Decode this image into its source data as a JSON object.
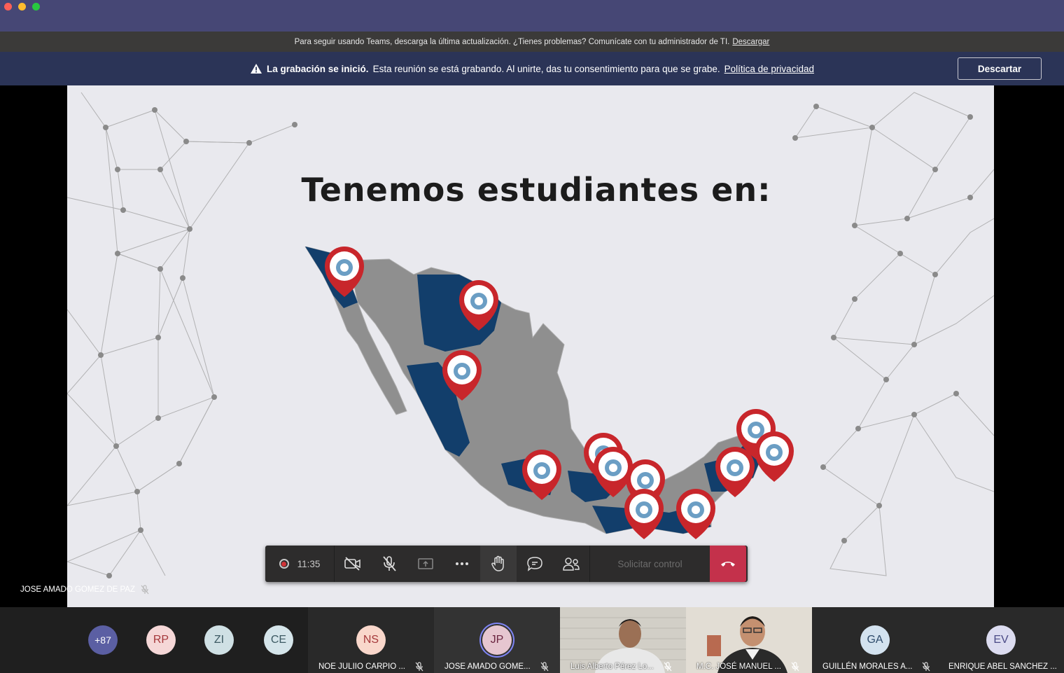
{
  "update_banner": {
    "text": "Para seguir usando Teams, descarga la última actualización. ¿Tienes problemas? Comunícate con tu administrador de TI.",
    "link": "Descargar"
  },
  "recording_banner": {
    "bold": "La grabación se inició.",
    "text": "Esta reunión se está grabando. Al unirte, das tu consentimiento para que se grabe.",
    "link": "Política de privacidad",
    "dismiss": "Descartar"
  },
  "slide": {
    "title": "Tenemos estudiantes en:"
  },
  "presenter": {
    "name": "JOSE AMADO GOMEZ DE PAZ"
  },
  "controls": {
    "timer": "11:35",
    "request_control": "Solicitar control"
  },
  "participants": {
    "overflow": "+87",
    "small_avatars": [
      {
        "initials": "RP",
        "bg": "#f5d7d7",
        "fg": "#a4373a"
      },
      {
        "initials": "ZI",
        "bg": "#cfe0e4",
        "fg": "#3d5a63"
      },
      {
        "initials": "CE",
        "bg": "#d5e5ea",
        "fg": "#3d5a63"
      }
    ],
    "tiles": [
      {
        "initials": "NS",
        "name": "NOE JULIIO CARPIO ...",
        "bg": "#f9d7cb",
        "fg": "#a4373a"
      },
      {
        "initials": "JP",
        "name": "JOSE AMADO GOME...",
        "bg": "#e6c6d0",
        "fg": "#6b2540"
      },
      {
        "initials": "",
        "name": "Luis Alberto Pérez Lo..."
      },
      {
        "initials": "",
        "name": "M.C. JOSÉ MANUEL ..."
      },
      {
        "initials": "GA",
        "name": "GUILLÉN MORALES A...",
        "bg": "#d3e2ef",
        "fg": "#2e4b6b"
      },
      {
        "initials": "EV",
        "name": "ENRIQUE ABEL SANCHEZ ...",
        "bg": "#dcdcf0",
        "fg": "#4b4b86"
      }
    ]
  },
  "colors": {
    "teams_purple": "#464775",
    "banner_dark": "#2b3457",
    "hangup": "#c4314b",
    "map_gray": "#8c8c8c",
    "map_blue": "#123e6b",
    "pin_red": "#c8262b"
  }
}
